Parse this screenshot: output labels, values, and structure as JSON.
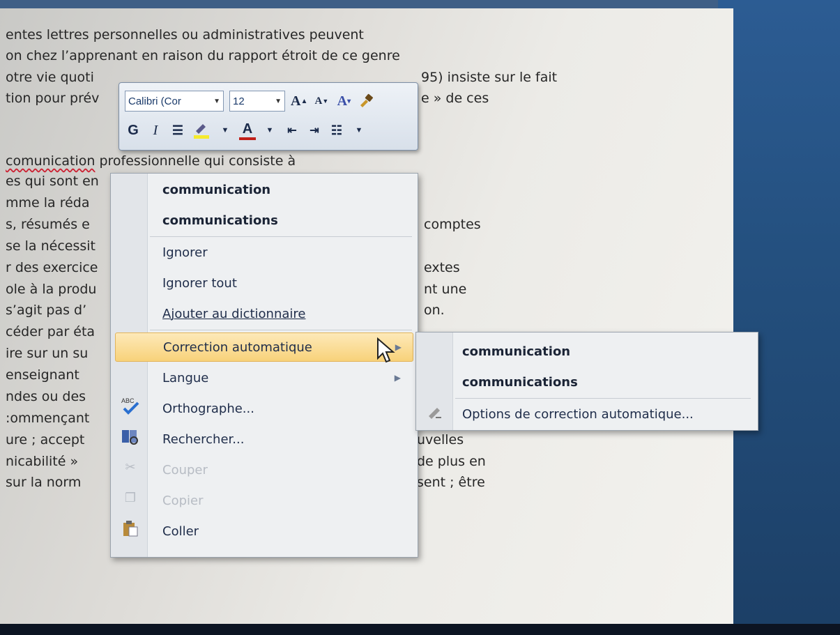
{
  "document": {
    "lines": [
      "entes lettres personnelles ou administratives  peuvent",
      "on chez l’apprenant en raison du rapport étroit de ce genre",
      "otre vie quoti",
      "tion pour prév",
      "",
      "comunication",
      "es qui sont en",
      "mme la réda",
      "s, résumés e",
      "se la nécessit",
      "r des exercice",
      "ole à la produ",
      " s’agit pas d’",
      "céder par éta",
      "ire sur un su",
      "enseignant",
      "ndes ou des",
      ":ommençant",
      "ure ; accept",
      "nicabilité  »",
      " sur la norm"
    ],
    "line3_right": "95) insiste sur le fait",
    "line4_right": "e » de ces",
    "line6_rest": " professionnelle qui consiste à",
    "right_fragments": [
      "comptes",
      "extes",
      "nt une",
      "on.",
      "uvelles",
      "de plus en",
      "sent ; être"
    ]
  },
  "mini_toolbar": {
    "font_name": "Calibri (Cor",
    "font_size": "12",
    "bold_label": "G",
    "italic_label": "I"
  },
  "context_menu": {
    "suggestions": [
      "communication",
      "communications"
    ],
    "ignore": "Ignorer",
    "ignore_all": "Ignorer tout",
    "add_dictionary": "Ajouter au dictionnaire",
    "autocorrect": "Correction automatique",
    "language": "Langue",
    "spelling": "Orthographe...",
    "lookup": "Rechercher...",
    "cut": "Couper",
    "copy": "Copier",
    "paste": "Coller"
  },
  "submenu": {
    "suggestions": [
      "communication",
      "communications"
    ],
    "options": "Options de correction automatique..."
  },
  "colors": {
    "highlight": "#f8d27a",
    "menu_bg": "#eef0f2",
    "chrome_blue": "#24507f"
  }
}
